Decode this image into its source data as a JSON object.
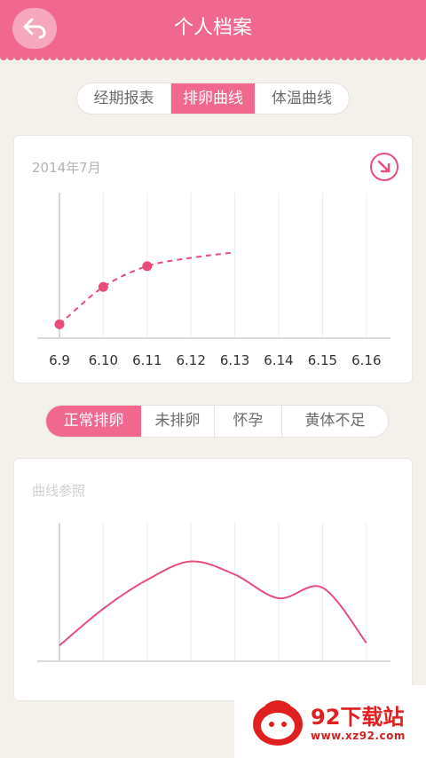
{
  "header": {
    "title": "个人档案",
    "back_icon": "back-arrow-icon",
    "color": "#f0688f"
  },
  "top_tabs": [
    {
      "label": "经期报表",
      "active": false
    },
    {
      "label": "排卵曲线",
      "active": true
    },
    {
      "label": "体温曲线",
      "active": false
    }
  ],
  "ovulation_card": {
    "month_label": "2014年7月",
    "expand_icon": "expand-arrow-icon"
  },
  "mode_tabs": [
    {
      "label": "正常排卵",
      "active": true
    },
    {
      "label": "未排卵",
      "active": false
    },
    {
      "label": "怀孕",
      "active": false
    },
    {
      "label": "黄体不足",
      "active": false
    }
  ],
  "reference_card": {
    "label": "曲线参照"
  },
  "watermark": {
    "name": "92下载站",
    "url": "www.xz92.com"
  },
  "chart_data": [
    {
      "type": "line",
      "categories": [
        "6.9",
        "6.10",
        "6.11",
        "6.12",
        "6.13",
        "6.14",
        "6.15",
        "6.16"
      ],
      "series": [
        {
          "values": [
            0.1,
            0.37,
            0.52
          ],
          "style": "dashed-with-points"
        },
        {
          "values": [
            0.1,
            0.37,
            0.52,
            0.58,
            0.62
          ],
          "style": "projection"
        }
      ],
      "ylim": [
        0,
        1
      ],
      "grid": true,
      "color": "#e84d7a"
    },
    {
      "type": "line",
      "categories": [
        "",
        "",
        "",
        "",
        "",
        "",
        "",
        ""
      ],
      "series": [
        {
          "values": [
            0.12,
            0.4,
            0.62,
            0.76,
            0.66,
            0.48,
            0.56,
            0.14
          ]
        }
      ],
      "ylim": [
        0,
        1
      ],
      "grid": true,
      "color": "#e84d7a"
    }
  ]
}
